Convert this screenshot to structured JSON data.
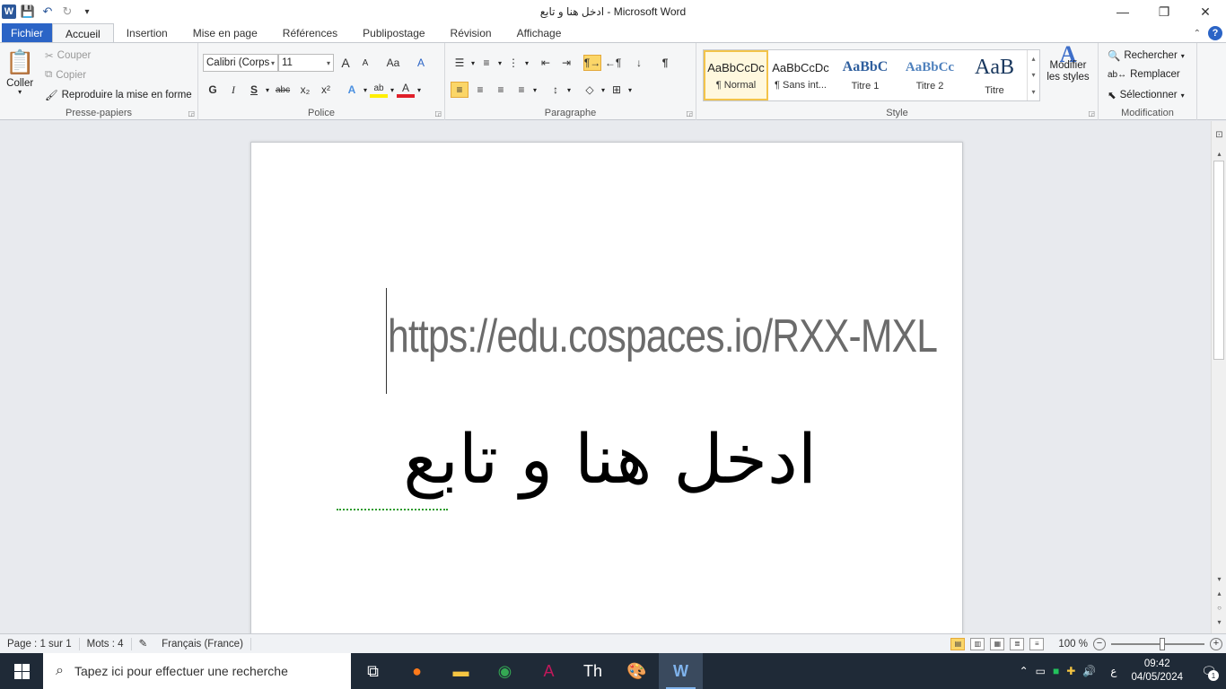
{
  "window": {
    "title": "ادخل هنا و تابع  -  Microsoft Word",
    "minimize": "—",
    "restore": "❐",
    "close": "✕"
  },
  "qat": {
    "logo": "W",
    "save": "💾",
    "undo": "↶",
    "redo": "↻",
    "customize": "▾"
  },
  "tabs": [
    "Fichier",
    "Accueil",
    "Insertion",
    "Mise en page",
    "Références",
    "Publipostage",
    "Révision",
    "Affichage"
  ],
  "ribbon": {
    "clipboard": {
      "label": "Presse-papiers",
      "paste": "Coller",
      "cut": "Couper",
      "copy": "Copier",
      "format_painter": "Reproduire la mise en forme"
    },
    "font": {
      "label": "Police",
      "font_name": "Calibri (Corps",
      "font_size": "11",
      "grow": "A",
      "shrink": "A",
      "case": "Aa",
      "clear": "A",
      "bold": "G",
      "italic": "I",
      "underline": "S",
      "strike": "abc",
      "subscript": "x₂",
      "superscript": "x²",
      "effects": "A",
      "highlight": "ab",
      "color": "A"
    },
    "paragraph": {
      "label": "Paragraphe",
      "show_marks": "¶"
    },
    "styles": {
      "label": "Style",
      "items": [
        {
          "preview": "AaBbCcDc",
          "name": "¶ Normal"
        },
        {
          "preview": "AaBbCcDc",
          "name": "¶ Sans int..."
        },
        {
          "preview": "AaBbC",
          "name": "Titre 1"
        },
        {
          "preview": "AaBbCc",
          "name": "Titre 2"
        },
        {
          "preview": "AaB",
          "name": "Titre"
        }
      ],
      "modify": "Modifier les styles"
    },
    "editing": {
      "label": "Modification",
      "find": "Rechercher",
      "replace": "Remplacer",
      "select": "Sélectionner"
    }
  },
  "document": {
    "line1": "https://edu.cospaces.io/RXX-MXL",
    "line2": "ادخل هنا و تابع"
  },
  "status": {
    "page": "Page : 1 sur 1",
    "words": "Mots : 4",
    "language": "Français (France)",
    "zoom": "100 %",
    "zoom_level": 1.0
  },
  "taskbar": {
    "search_placeholder": "Tapez ici pour effectuer une recherche",
    "lang": "ع",
    "time": "09:42",
    "date": "04/05/2024",
    "notif_count": "1"
  },
  "colors": {
    "accent": "#2b579a",
    "file_tab": "#2b64c6",
    "selected": "#fbd668",
    "taskbar": "#1f2a37"
  }
}
